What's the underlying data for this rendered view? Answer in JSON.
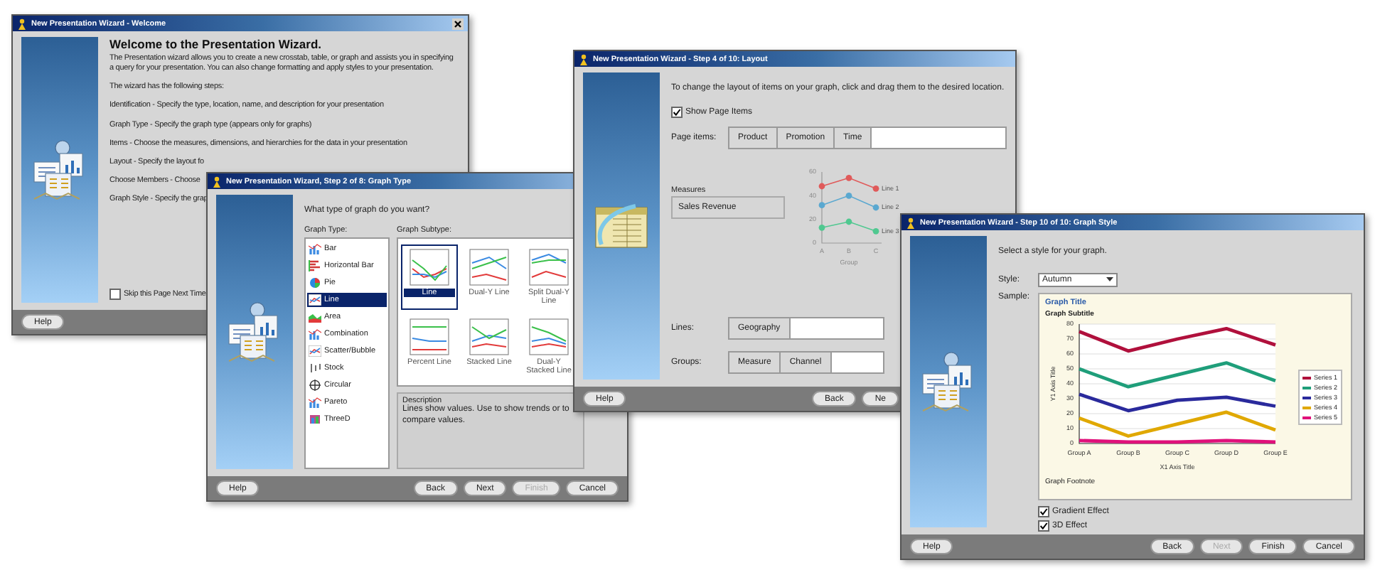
{
  "windows": [
    {
      "kind": "welcome",
      "title": "New Presentation Wizard - Welcome",
      "close": true,
      "heading": "Welcome to the Presentation Wizard.",
      "intro": "The Presentation wizard allows you to create a new crosstab, table, or graph and assists you in specifying a query for your presentation. You can also change formatting and apply styles to your presentation.",
      "steps_intro": "The wizard has the following steps:",
      "steps": [
        "Identification - Specify the type, location, name, and description for your presentation",
        "Graph Type - Specify the graph type (appears only for graphs)",
        "Items - Choose the measures, dimensions, and hierarchies for the data in your presentation",
        "Layout - Specify the layout fo",
        "Choose Members - Choose",
        "Graph Style - Specify the grap"
      ],
      "skip_checkbox": {
        "label": "Skip this Page Next Time",
        "checked": false
      },
      "help_button": "Help"
    },
    {
      "kind": "graph_type",
      "title": "New Presentation Wizard, Step 2 of 8: Graph Type",
      "close": false,
      "question": "What type of graph do you want?",
      "type_label": "Graph Type:",
      "types": [
        {
          "label": "Bar",
          "selected": false
        },
        {
          "label": "Horizontal Bar",
          "selected": false
        },
        {
          "label": "Pie",
          "selected": false
        },
        {
          "label": "Line",
          "selected": true
        },
        {
          "label": "Area",
          "selected": false
        },
        {
          "label": "Combination",
          "selected": false
        },
        {
          "label": "Scatter/Bubble",
          "selected": false
        },
        {
          "label": "Stock",
          "selected": false
        },
        {
          "label": "Circular",
          "selected": false
        },
        {
          "label": "Pareto",
          "selected": false
        },
        {
          "label": "ThreeD",
          "selected": false
        }
      ],
      "subtype_label": "Graph Subtype:",
      "subtypes": [
        {
          "label": "Line",
          "selected": true
        },
        {
          "label": "Dual-Y Line",
          "selected": false
        },
        {
          "label": "Split Dual-Y Line",
          "selected": false
        },
        {
          "label": "Percent Line",
          "selected": false
        },
        {
          "label": "Stacked Line",
          "selected": false
        },
        {
          "label": "Dual-Y Stacked Line",
          "selected": false
        }
      ],
      "description_label": "Description",
      "description": "Lines show values. Use to show trends or to compare values.",
      "help_button": "Help",
      "buttons": [
        {
          "label": "Back",
          "disabled": false
        },
        {
          "label": "Next",
          "disabled": false
        },
        {
          "label": "Finish",
          "disabled": true
        },
        {
          "label": "Cancel",
          "disabled": false
        }
      ]
    },
    {
      "kind": "layout",
      "title": "New Presentation Wizard - Step 4 of 10: Layout",
      "close": false,
      "instruction": "To change the layout of items on your graph, click and drag them to the desired location.",
      "show_checkbox": {
        "label": "Show Page Items",
        "checked": true
      },
      "page_items_label": "Page items:",
      "page_items": [
        "Product",
        "Promotion",
        "Time"
      ],
      "measures_label": "Measures",
      "measures": [
        "Sales Revenue"
      ],
      "chart_data": {
        "type": "line",
        "categories": [
          "A",
          "B",
          "C"
        ],
        "xlabel": "Group",
        "yticks": [
          0,
          20,
          40,
          60
        ],
        "ylim": [
          0,
          60
        ],
        "series": [
          {
            "name": "Line 1",
            "color": "#e05a5a",
            "marker": "circle",
            "values": [
              48,
              55,
              46
            ]
          },
          {
            "name": "Line 2",
            "color": "#5aa8d0",
            "marker": "circle",
            "values": [
              32,
              40,
              30
            ]
          },
          {
            "name": "Line 3",
            "color": "#50c890",
            "marker": "circle",
            "values": [
              13,
              18,
              10
            ]
          }
        ]
      },
      "lines_label": "Lines:",
      "lines_items": [
        "Geography"
      ],
      "groups_label": "Groups:",
      "groups_items": [
        "Measure",
        "Channel"
      ],
      "help_button": "Help",
      "buttons": [
        {
          "label": "Back",
          "disabled": false
        },
        {
          "label": "Ne",
          "disabled": false
        }
      ]
    },
    {
      "kind": "style",
      "title": "New Presentation Wizard - Step 10 of 10: Graph Style",
      "close": false,
      "instruction": "Select a style for your graph.",
      "style_label": "Style:",
      "style_value": "Autumn",
      "sample_label": "Sample:",
      "subtitle": "Graph Subtitle",
      "footnote": "Graph Footnote",
      "chart_data": {
        "type": "line",
        "title": "Graph Title",
        "categories": [
          "Group A",
          "Group B",
          "Group C",
          "Group D",
          "Group E"
        ],
        "xlabel": "X1 Axis Title",
        "ylabel": "Y1 Axis Title",
        "ylim": [
          0,
          80
        ],
        "grid": true,
        "yticks": [
          0,
          10,
          20,
          30,
          40,
          50,
          60,
          70,
          80
        ],
        "series": [
          {
            "name": "Series 1",
            "color": "#b0103c",
            "values": [
              75,
              62,
              70,
              77,
              66
            ]
          },
          {
            "name": "Series 2",
            "color": "#1f9e7a",
            "values": [
              50,
              38,
              46,
              54,
              42
            ]
          },
          {
            "name": "Series 3",
            "color": "#2a2a9c",
            "values": [
              33,
              22,
              29,
              31,
              25
            ]
          },
          {
            "name": "Series 4",
            "color": "#e0a800",
            "values": [
              17,
              5,
              13,
              21,
              9
            ]
          },
          {
            "name": "Series 5",
            "color": "#e0107a",
            "values": [
              2,
              1,
              1,
              2,
              1
            ]
          }
        ]
      },
      "options": [
        {
          "label": "Gradient Effect",
          "checked": true
        },
        {
          "label": "3D Effect",
          "checked": true
        }
      ],
      "help_button": "Help",
      "buttons": [
        {
          "label": "Back",
          "disabled": false
        },
        {
          "label": "Next",
          "disabled": true
        },
        {
          "label": "Finish",
          "disabled": false
        },
        {
          "label": "Cancel",
          "disabled": false
        }
      ]
    }
  ]
}
